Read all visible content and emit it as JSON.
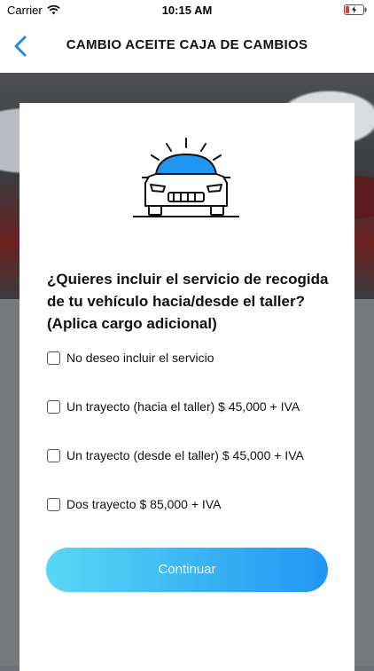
{
  "status_bar": {
    "carrier": "Carrier",
    "time": "10:15 AM"
  },
  "header": {
    "title": "CAMBIO ACEITE CAJA DE CAMBIOS"
  },
  "card": {
    "question": "¿Quieres incluir el servicio de recogida de tu vehículo hacia/desde el taller? (Aplica cargo adicional)",
    "options": [
      {
        "label": "No deseo incluir el servicio",
        "checked": false
      },
      {
        "label": "Un trayecto (hacia el taller) $ 45,000 + IVA",
        "checked": false
      },
      {
        "label": "Un trayecto (desde el taller) $ 45,000 + IVA",
        "checked": false
      },
      {
        "label": "Dos trayecto $ 85,000 + IVA",
        "checked": false
      }
    ],
    "continue_label": "Continuar"
  },
  "colors": {
    "accent": "#2196f3",
    "button_gradient_start": "#5ad7f5",
    "button_gradient_end": "#2196f3",
    "battery_low": "#e53935"
  },
  "icons": [
    "wifi-icon",
    "battery-icon",
    "back-chevron-icon",
    "car-wash-icon"
  ]
}
